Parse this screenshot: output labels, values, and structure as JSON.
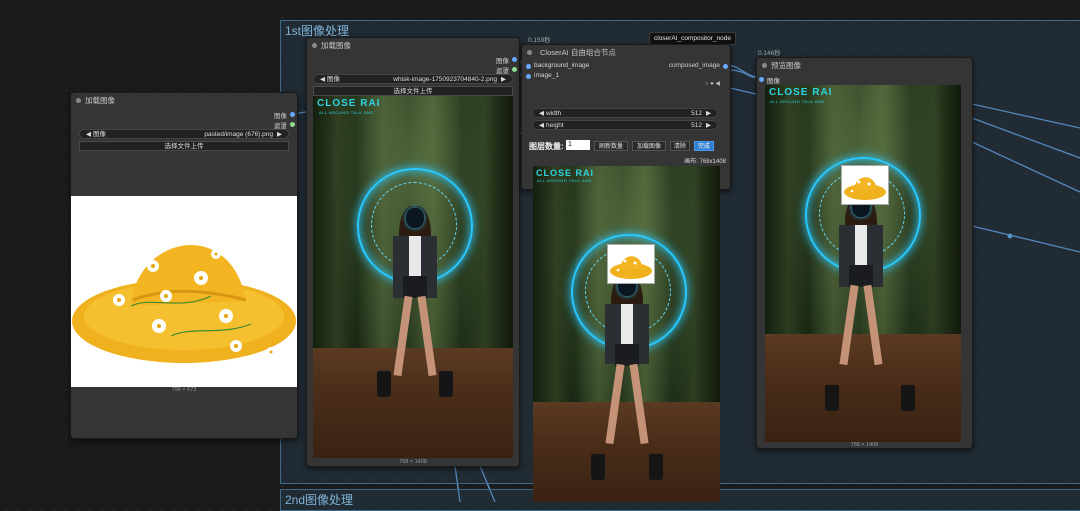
{
  "groups": {
    "first_title": "1st图像处理",
    "second_title": "2nd图像处理"
  },
  "node_load_left": {
    "title": "加载图像",
    "out_image": "图像",
    "out_mask": "遮罩",
    "combo_label": "图像",
    "combo_value": "pasted/image (676).png",
    "upload_label": "选择文件上传",
    "size_caption": "796 × 673"
  },
  "node_load_mid": {
    "title": "加载图像",
    "out_image": "图像",
    "out_mask": "遮罩",
    "combo_label": "图像",
    "combo_value": "whisk-image-1750923704840-2.png",
    "upload_label": "选择文件上传",
    "size_caption": "768 × 1408",
    "logo_main": "CLOSE RAI",
    "logo_sub": "ALL AROUND TALK AND"
  },
  "node_compositor": {
    "time": "0.159秒",
    "badge": "closerAI_compositor_node",
    "title": "CloserAI 自由组合节点",
    "in_bg": "background_image",
    "in_img1": "image_1",
    "out_composed": "composed_image",
    "width_label": "width",
    "width_value": "512",
    "height_label": "height",
    "height_value": "512",
    "layers_label": "图层数量:",
    "layers_value": "1",
    "btn_refresh": "刷新数量",
    "btn_load": "加载图像",
    "btn_clear": "清除",
    "btn_done": "完成",
    "canvas_label": "画布: 768x1408",
    "logo_main": "CLOSE RAI",
    "logo_sub": "ALL AROUND TALK AND"
  },
  "node_preview": {
    "time": "0.146秒",
    "title": "预览图像",
    "in_image": "图像",
    "size_caption": "768 × 1408",
    "logo_main": "CLOSE RAI",
    "logo_sub": "ALL AROUND TALK AND"
  },
  "colors": {
    "accent": "#66aaff",
    "group": "#3d6a8a",
    "glow": "#29c8ff",
    "hat": "#f2b722"
  }
}
